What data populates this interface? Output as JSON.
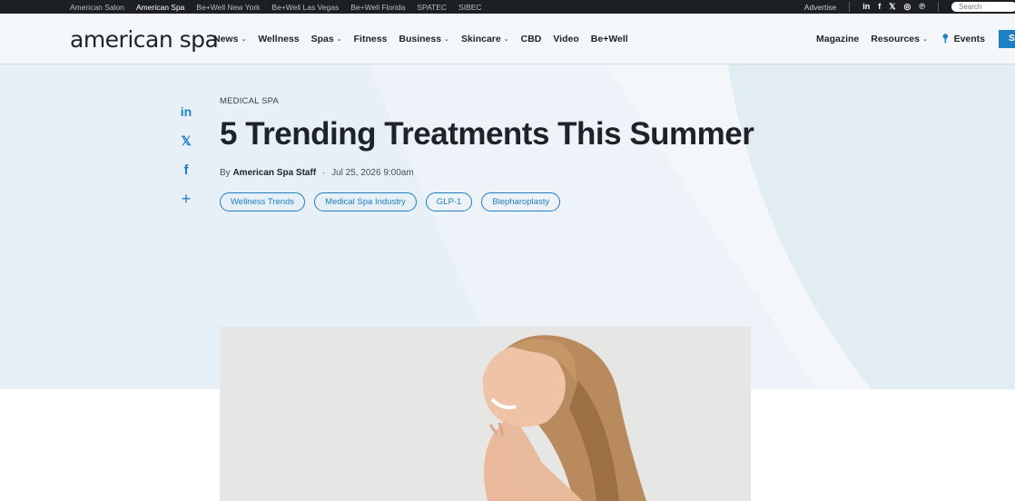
{
  "topbar": {
    "brands": [
      "American Salon",
      "American Spa",
      "Be+Well New York",
      "Be+Well Las Vegas",
      "Be+Well Florida",
      "SPATEC",
      "SIBEC"
    ],
    "advertise": "Advertise",
    "social_icons": [
      "linkedin-icon",
      "facebook-icon",
      "x-icon",
      "instagram-icon",
      "pinterest-icon"
    ],
    "social_glyphs": [
      "in",
      "f",
      "𝕏",
      "◎",
      "℗"
    ],
    "search_placeholder": "Search"
  },
  "nav": {
    "logo": "american spa",
    "links": [
      {
        "label": "News",
        "dropdown": true
      },
      {
        "label": "Wellness",
        "dropdown": false
      },
      {
        "label": "Spas",
        "dropdown": true
      },
      {
        "label": "Fitness",
        "dropdown": false
      },
      {
        "label": "Business",
        "dropdown": true
      },
      {
        "label": "Skincare",
        "dropdown": true
      },
      {
        "label": "CBD",
        "dropdown": false
      },
      {
        "label": "Video",
        "dropdown": false
      },
      {
        "label": "Be+Well",
        "dropdown": false
      }
    ],
    "right": {
      "magazine": "Magazine",
      "resources": "Resources",
      "events": "Events",
      "subscribe": "S"
    }
  },
  "share": {
    "linkedin": "in",
    "x": "𝕏",
    "facebook": "f",
    "more": "+"
  },
  "article": {
    "kicker": "MEDICAL SPA",
    "title": "5 Trending Treatments This Summer",
    "byline_prefix": "By",
    "author": "American Spa Staff",
    "separator": "·",
    "date": "Jul 25, 2026 9:00am",
    "tags": [
      "Wellness Trends",
      "Medical Spa Industry",
      "GLP-1",
      "Blepharoplasty"
    ]
  },
  "colors": {
    "accent": "#1f7fc4",
    "topbar": "#1c2024",
    "hero": "#e7f0f6",
    "text": "#1e2329"
  }
}
